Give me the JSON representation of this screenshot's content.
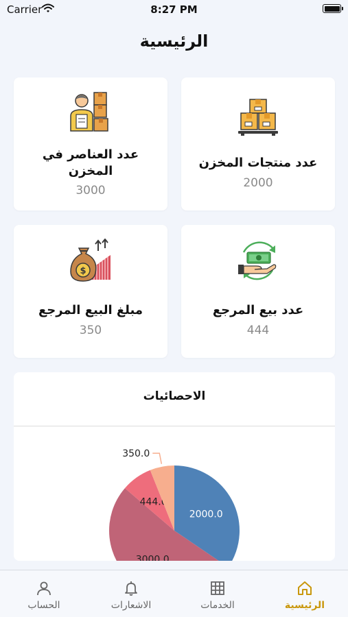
{
  "status_bar": {
    "carrier": "Carrier",
    "time": "8:27 PM"
  },
  "header": {
    "title": "الرئيسية"
  },
  "cards": [
    {
      "label": "عدد منتجات المخزن",
      "value": "2000",
      "icon": "boxes-icon"
    },
    {
      "label": "عدد العناصر في المخزن",
      "value": "3000",
      "icon": "worker-boxes-icon"
    },
    {
      "label": "عدد بيع المرجع",
      "value": "444",
      "icon": "cash-hand-icon"
    },
    {
      "label": "مبلغ البيع المرجع",
      "value": "350",
      "icon": "money-bag-growth-icon"
    }
  ],
  "stats": {
    "title": "الاحصائيات"
  },
  "chart_data": {
    "type": "pie",
    "values": [
      2000,
      3000,
      444,
      350
    ],
    "data_labels": [
      "2000.0",
      "3000.0",
      "444.0",
      "350.0"
    ],
    "colors": [
      "#4f82b7",
      "#c06477",
      "#ee6d7c",
      "#f7ae8e"
    ]
  },
  "tabbar": {
    "items": [
      {
        "label": "الرئيسية",
        "icon": "home-icon",
        "active": true
      },
      {
        "label": "الخدمات",
        "icon": "grid-icon",
        "active": false
      },
      {
        "label": "الاشعارات",
        "icon": "bell-icon",
        "active": false
      },
      {
        "label": "الحساب",
        "icon": "user-icon",
        "active": false
      }
    ]
  },
  "colors": {
    "accent": "#c9970c",
    "background": "#f2f5fb",
    "card": "#ffffff",
    "muted": "#8a8a8a"
  }
}
